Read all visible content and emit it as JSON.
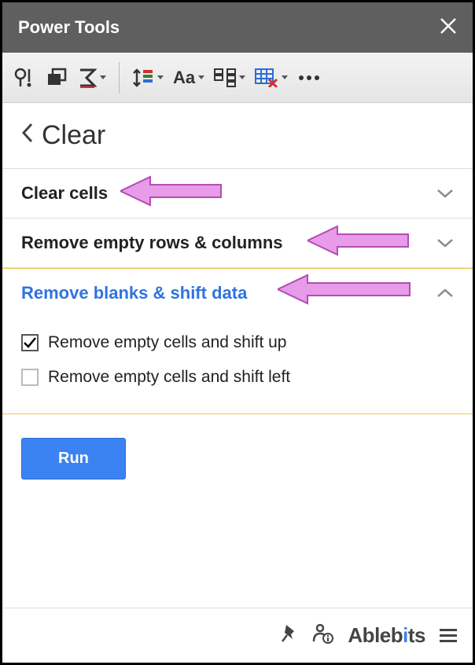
{
  "header": {
    "title": "Power Tools"
  },
  "breadcrumb": {
    "label": "Clear"
  },
  "sections": {
    "clear_cells": {
      "title": "Clear cells"
    },
    "remove_empty": {
      "title": "Remove empty rows & columns"
    },
    "remove_blanks": {
      "title": "Remove blanks & shift data",
      "opt_up": "Remove empty cells and shift up",
      "opt_left": "Remove empty cells and shift left"
    }
  },
  "run_label": "Run",
  "brand": {
    "prefix": "Ableb",
    "accent": "i",
    "suffix": "ts"
  },
  "toolbar_text": {
    "aa": "Aa"
  }
}
